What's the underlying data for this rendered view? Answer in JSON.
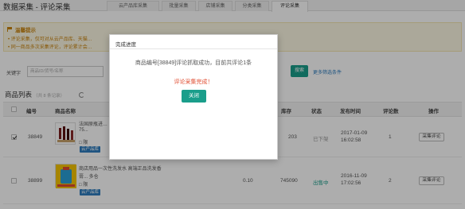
{
  "header": {
    "title": "数据采集 - 评论采集",
    "tabs": [
      {
        "label": "云产品库采集",
        "active": false
      },
      {
        "label": "批量采集",
        "active": false
      },
      {
        "label": "店铺采集",
        "active": false
      },
      {
        "label": "分类采集",
        "active": false
      },
      {
        "label": "评论采集",
        "active": true
      }
    ]
  },
  "notice": {
    "title": "温馨提示",
    "lines": [
      "评论采集，仅可对从云产品库、天猫…",
      "同一商品多次采集评论，评论累计会…"
    ]
  },
  "search": {
    "label": "关键字",
    "placeholder": "商品ID/货号/名称",
    "button": "搜索",
    "more": "更多筛选条件"
  },
  "list": {
    "title": "商品列表",
    "count": "（共 8 条记录）",
    "columns": [
      "编号",
      "商品名称",
      "库存",
      "状态",
      "发布时间",
      "评论数",
      "操作"
    ],
    "rows": [
      {
        "checked": true,
        "id": "38849",
        "name_line1": "法国原瓶进…",
        "name_line2": "75...",
        "flags": "□ 限",
        "tag": "云产品库",
        "price": "",
        "stock": "203",
        "status": "已下架",
        "date": "2017-01-09",
        "time": "16:02:58",
        "comments": "1",
        "action": "采集评论"
      },
      {
        "checked": false,
        "id": "38899",
        "name_line1": "商店用品一次性洗发水 高端正品洗发香",
        "name_line2": "膏... 多仓",
        "flags": "□ 限",
        "tag": "云产品库",
        "price": "0.10",
        "stock": "745090",
        "status": "出售中",
        "date": "2016-11-09",
        "time": "17:02:56",
        "comments": "2",
        "action": "采集评论"
      }
    ]
  },
  "modal": {
    "title": "完成进度",
    "message": "商品编号[38849]评论抓取成功，目前共评论1条",
    "done": "评论采集完成！",
    "close": "关闭"
  },
  "colors": {
    "accent": "#1a9e8b",
    "link": "#2e7dbe",
    "warning": "#c9830e",
    "success_text": "#e04b2f"
  }
}
